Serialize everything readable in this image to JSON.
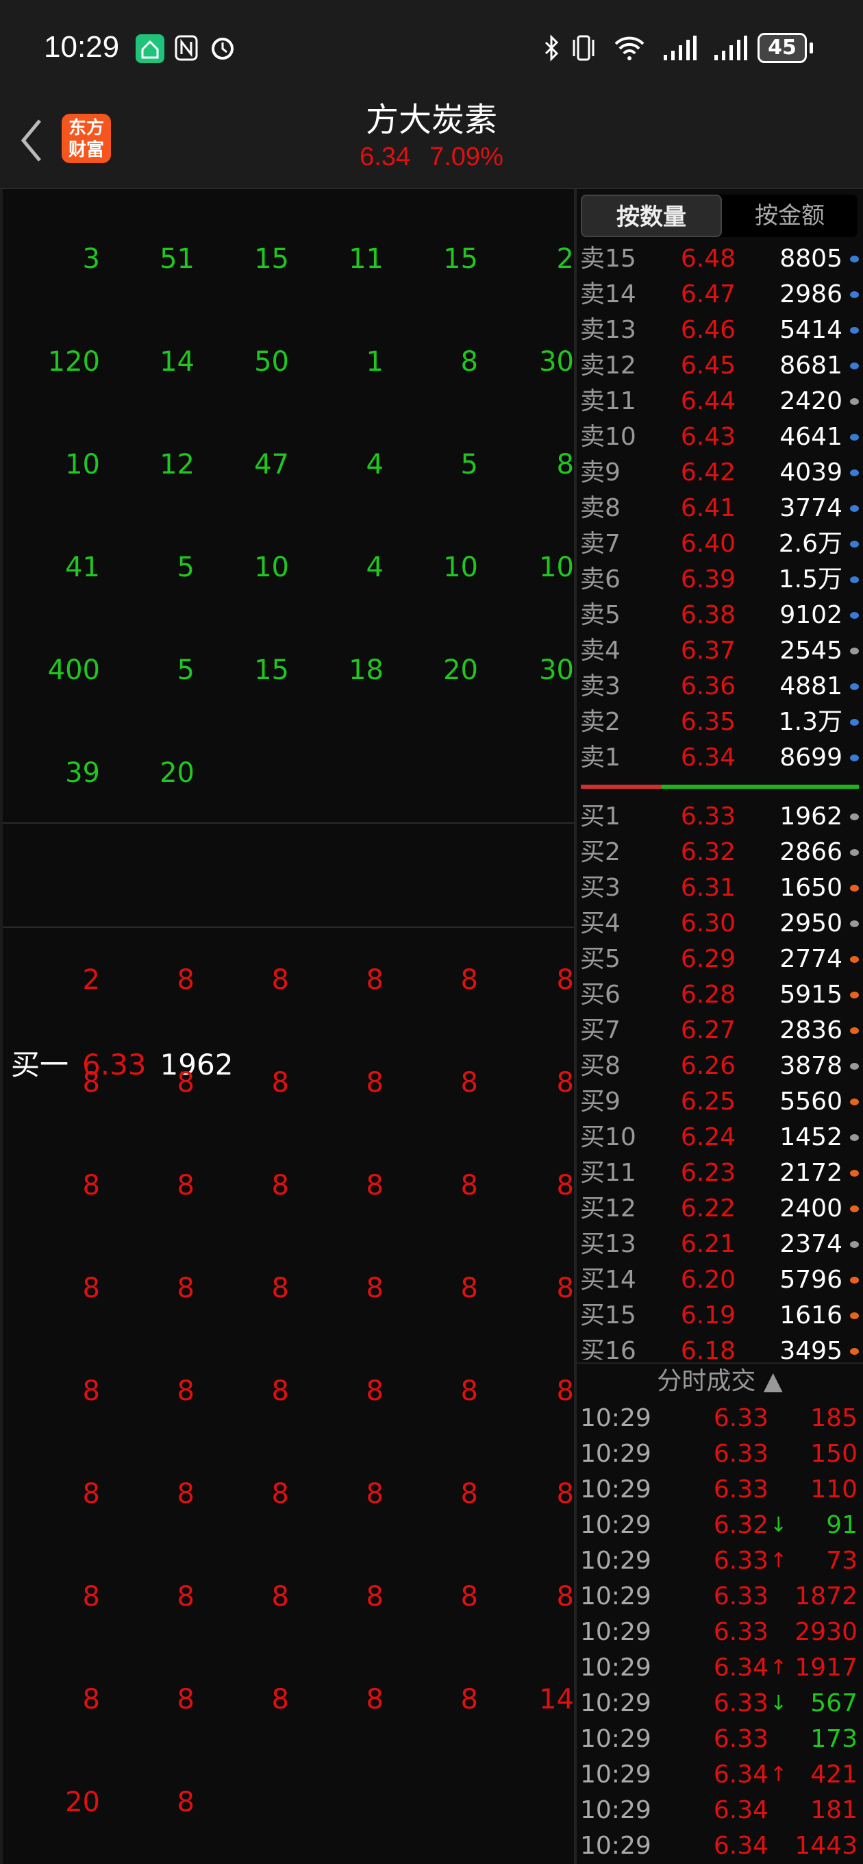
{
  "status_bar": {
    "time": "10:29",
    "battery": "45",
    "icons": [
      "app-notification-icon",
      "nfc-icon",
      "alarm-icon",
      "bluetooth-icon",
      "vibrate-icon",
      "wifi-icon",
      "signal-icon",
      "signal-icon",
      "battery-icon"
    ]
  },
  "header": {
    "title": "方大炭素",
    "price": "6.34",
    "change_pct": "7.09%",
    "logo_text": "东方财富",
    "back_icon": "chevron-left-icon"
  },
  "colors": {
    "up": "#e01010",
    "down": "#1ec81e",
    "background": "#0c0c0c",
    "dot_blue": "#3a7bd5",
    "dot_grey": "#9a9a9a",
    "dot_orange": "#e8641e"
  },
  "sell_queue": [
    [
      "3",
      "51",
      "15",
      "11",
      "15",
      "2"
    ],
    [
      "120",
      "14",
      "50",
      "1",
      "8",
      "30"
    ],
    [
      "10",
      "12",
      "47",
      "4",
      "5",
      "8"
    ],
    [
      "41",
      "5",
      "10",
      "4",
      "10",
      "10"
    ],
    [
      "400",
      "5",
      "15",
      "18",
      "20",
      "30"
    ],
    [
      "39",
      "20"
    ]
  ],
  "buy_one": {
    "label": "买一",
    "price": "6.33",
    "volume": "1962"
  },
  "buy_queue": [
    [
      "2",
      "8",
      "8",
      "8",
      "8",
      "8"
    ],
    [
      "8",
      "8",
      "8",
      "8",
      "8",
      "8"
    ],
    [
      "8",
      "8",
      "8",
      "8",
      "8",
      "8"
    ],
    [
      "8",
      "8",
      "8",
      "8",
      "8",
      "8"
    ],
    [
      "8",
      "8",
      "8",
      "8",
      "8",
      "8"
    ],
    [
      "8",
      "8",
      "8",
      "8",
      "8",
      "8"
    ],
    [
      "8",
      "8",
      "8",
      "8",
      "8",
      "8"
    ],
    [
      "8",
      "8",
      "8",
      "8",
      "8",
      "14"
    ],
    [
      "20",
      "8"
    ]
  ],
  "tabs": [
    {
      "label": "按数量",
      "active": true
    },
    {
      "label": "按金额",
      "active": false
    }
  ],
  "asks": [
    {
      "label": "卖15",
      "price": "6.48",
      "qty": "8805",
      "dot": "blue"
    },
    {
      "label": "卖14",
      "price": "6.47",
      "qty": "2986",
      "dot": "blue"
    },
    {
      "label": "卖13",
      "price": "6.46",
      "qty": "5414",
      "dot": "blue"
    },
    {
      "label": "卖12",
      "price": "6.45",
      "qty": "8681",
      "dot": "blue"
    },
    {
      "label": "卖11",
      "price": "6.44",
      "qty": "2420",
      "dot": "grey"
    },
    {
      "label": "卖10",
      "price": "6.43",
      "qty": "4641",
      "dot": "blue"
    },
    {
      "label": "卖9",
      "price": "6.42",
      "qty": "4039",
      "dot": "blue"
    },
    {
      "label": "卖8",
      "price": "6.41",
      "qty": "3774",
      "dot": "blue"
    },
    {
      "label": "卖7",
      "price": "6.40",
      "qty": "2.6万",
      "dot": "blue"
    },
    {
      "label": "卖6",
      "price": "6.39",
      "qty": "1.5万",
      "dot": "blue"
    },
    {
      "label": "卖5",
      "price": "6.38",
      "qty": "9102",
      "dot": "blue"
    },
    {
      "label": "卖4",
      "price": "6.37",
      "qty": "2545",
      "dot": "grey"
    },
    {
      "label": "卖3",
      "price": "6.36",
      "qty": "4881",
      "dot": "blue"
    },
    {
      "label": "卖2",
      "price": "6.35",
      "qty": "1.3万",
      "dot": "blue"
    },
    {
      "label": "卖1",
      "price": "6.34",
      "qty": "8699",
      "dot": "blue"
    }
  ],
  "bid_ask_ratio_red_pct": 29,
  "bids": [
    {
      "label": "买1",
      "price": "6.33",
      "qty": "1962",
      "dot": "grey"
    },
    {
      "label": "买2",
      "price": "6.32",
      "qty": "2866",
      "dot": "grey"
    },
    {
      "label": "买3",
      "price": "6.31",
      "qty": "1650",
      "dot": "orange"
    },
    {
      "label": "买4",
      "price": "6.30",
      "qty": "2950",
      "dot": "grey"
    },
    {
      "label": "买5",
      "price": "6.29",
      "qty": "2774",
      "dot": "orange"
    },
    {
      "label": "买6",
      "price": "6.28",
      "qty": "5915",
      "dot": "orange"
    },
    {
      "label": "买7",
      "price": "6.27",
      "qty": "2836",
      "dot": "orange"
    },
    {
      "label": "买8",
      "price": "6.26",
      "qty": "3878",
      "dot": "grey"
    },
    {
      "label": "买9",
      "price": "6.25",
      "qty": "5560",
      "dot": "orange"
    },
    {
      "label": "买10",
      "price": "6.24",
      "qty": "1452",
      "dot": "grey"
    },
    {
      "label": "买11",
      "price": "6.23",
      "qty": "2172",
      "dot": "orange"
    },
    {
      "label": "买12",
      "price": "6.22",
      "qty": "2400",
      "dot": "orange"
    },
    {
      "label": "买13",
      "price": "6.21",
      "qty": "2374",
      "dot": "grey"
    },
    {
      "label": "买14",
      "price": "6.20",
      "qty": "5796",
      "dot": "orange"
    },
    {
      "label": "买15",
      "price": "6.19",
      "qty": "1616",
      "dot": "orange"
    },
    {
      "label": "买16",
      "price": "6.18",
      "qty": "3495",
      "dot": "orange"
    }
  ],
  "trades_header": "分时成交 ▲",
  "trades": [
    {
      "time": "10:29",
      "price": "6.33",
      "arrow": "",
      "qty": "185",
      "side": "up"
    },
    {
      "time": "10:29",
      "price": "6.33",
      "arrow": "",
      "qty": "150",
      "side": "up"
    },
    {
      "time": "10:29",
      "price": "6.33",
      "arrow": "",
      "qty": "110",
      "side": "up"
    },
    {
      "time": "10:29",
      "price": "6.32",
      "arrow": "↓",
      "qty": "91",
      "side": "down"
    },
    {
      "time": "10:29",
      "price": "6.33",
      "arrow": "↑",
      "qty": "73",
      "side": "up"
    },
    {
      "time": "10:29",
      "price": "6.33",
      "arrow": "",
      "qty": "1872",
      "side": "up"
    },
    {
      "time": "10:29",
      "price": "6.33",
      "arrow": "",
      "qty": "2930",
      "side": "up"
    },
    {
      "time": "10:29",
      "price": "6.34",
      "arrow": "↑",
      "qty": "1917",
      "side": "up"
    },
    {
      "time": "10:29",
      "price": "6.33",
      "arrow": "↓",
      "qty": "567",
      "side": "down"
    },
    {
      "time": "10:29",
      "price": "6.33",
      "arrow": "",
      "qty": "173",
      "side": "down"
    },
    {
      "time": "10:29",
      "price": "6.34",
      "arrow": "↑",
      "qty": "421",
      "side": "up"
    },
    {
      "time": "10:29",
      "price": "6.34",
      "arrow": "",
      "qty": "181",
      "side": "up"
    },
    {
      "time": "10:29",
      "price": "6.34",
      "arrow": "",
      "qty": "1443",
      "side": "up"
    }
  ]
}
